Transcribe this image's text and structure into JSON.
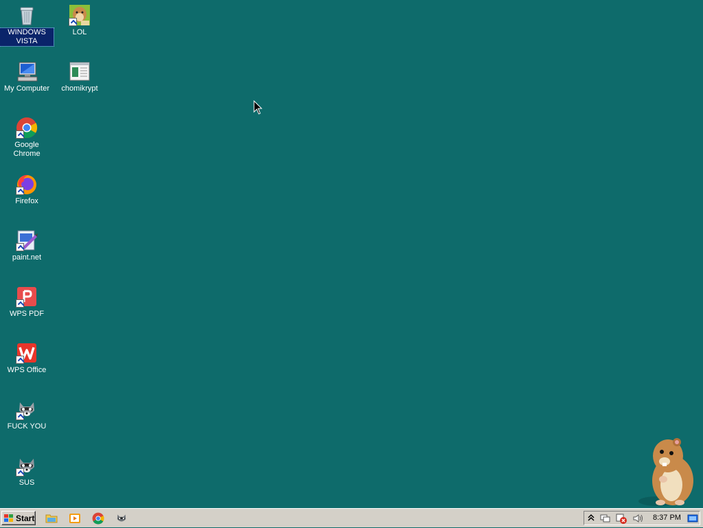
{
  "desktop_icons": [
    {
      "label": "WINDOWS VISTA",
      "icon": "recycle-bin-icon"
    },
    {
      "label": "LOL",
      "icon": "hamster-box-icon"
    },
    {
      "label": "My Computer",
      "icon": "computer-icon"
    },
    {
      "label": "chomikrypt",
      "icon": "document-app-icon"
    },
    {
      "label": "Google Chrome",
      "icon": "chrome-icon"
    },
    {
      "label": "Firefox",
      "icon": "firefox-icon"
    },
    {
      "label": "paint.net",
      "icon": "paintnet-icon"
    },
    {
      "label": "WPS PDF",
      "icon": "wps-pdf-icon"
    },
    {
      "label": "WPS Office",
      "icon": "wps-office-icon"
    },
    {
      "label": "FUCK YOU",
      "icon": "raccoon-icon"
    },
    {
      "label": "SUS",
      "icon": "raccoon-icon"
    }
  ],
  "taskbar": {
    "start_label": "Start",
    "quick_launch": [
      "file-explorer-icon",
      "media-player-icon",
      "chrome-icon",
      "raccoon-icon"
    ],
    "tray_icons": [
      "show-hidden-icons-chevron",
      "network-icon",
      "security-alert-icon",
      "volume-icon",
      "show-desktop-icon"
    ],
    "clock": "8:37 PM"
  },
  "colors": {
    "desktop_background": "#0e6b6b",
    "taskbar": "#d4d0c8",
    "selection": "#0a246a"
  }
}
